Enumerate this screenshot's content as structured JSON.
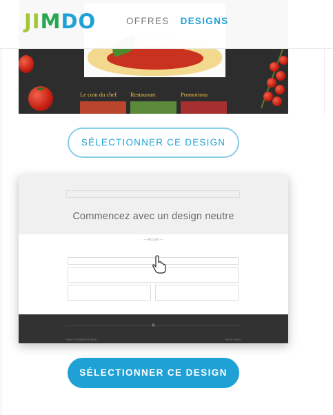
{
  "header": {
    "logo_letters": [
      "J",
      "I",
      "M",
      "D",
      "O"
    ],
    "nav": [
      {
        "label": "OFFRES",
        "active": false
      },
      {
        "label": "DESIGNS",
        "active": true
      }
    ]
  },
  "design1": {
    "menu": [
      "Le coin du chef",
      "Restaurant",
      "Promotions"
    ],
    "button_label": "SÉLECTIONNER CE DESIGN"
  },
  "design2": {
    "title": "Commencez avec un design neutre",
    "menu_label": "— Accueil —",
    "footer_left": "Mes Conditions | Mise",
    "footer_right": "Jimdo Seite",
    "button_label": "SÉLECTIONNER CE DESIGN"
  },
  "colors": {
    "accent": "#1fa1d6",
    "logo_green": "#a0c832",
    "logo_blue": "#1fa1d6"
  }
}
